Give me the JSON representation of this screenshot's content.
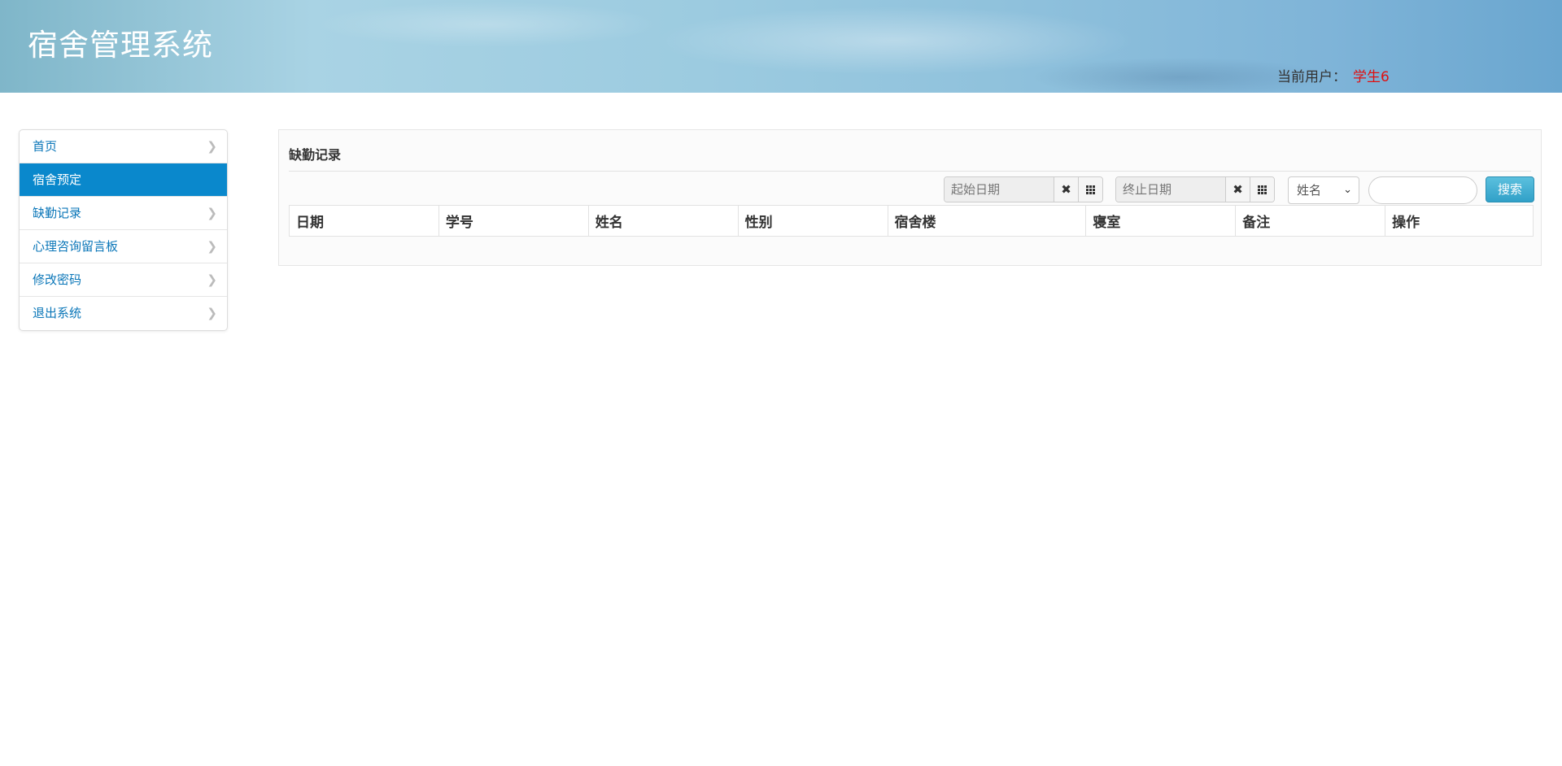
{
  "header": {
    "app_title": "宿舍管理系统",
    "user_label": "当前用户：",
    "user_name": "学生6"
  },
  "sidebar": {
    "items": [
      {
        "label": "首页",
        "active": false
      },
      {
        "label": "宿舍预定",
        "active": true
      },
      {
        "label": "缺勤记录",
        "active": false
      },
      {
        "label": "心理咨询留言板",
        "active": false
      },
      {
        "label": "修改密码",
        "active": false
      },
      {
        "label": "退出系统",
        "active": false
      }
    ],
    "chevron_icon": "chevron-right-icon"
  },
  "main": {
    "title": "缺勤记录",
    "start_date": {
      "placeholder": "起始日期",
      "value": ""
    },
    "end_date": {
      "placeholder": "终止日期",
      "value": ""
    },
    "clear_icon": "close-icon",
    "calendar_icon": "grid-icon",
    "search_field": {
      "selected": "姓名"
    },
    "search_input": {
      "value": ""
    },
    "search_button": "搜索",
    "table": {
      "columns": [
        "日期",
        "学号",
        "姓名",
        "性别",
        "宿舍楼",
        "寝室",
        "备注",
        "操作"
      ],
      "rows": []
    }
  },
  "colors": {
    "accent": "#0a88cc",
    "link": "#0a76b8",
    "user_name": "#e01010",
    "search_button": "#31a0c8"
  }
}
